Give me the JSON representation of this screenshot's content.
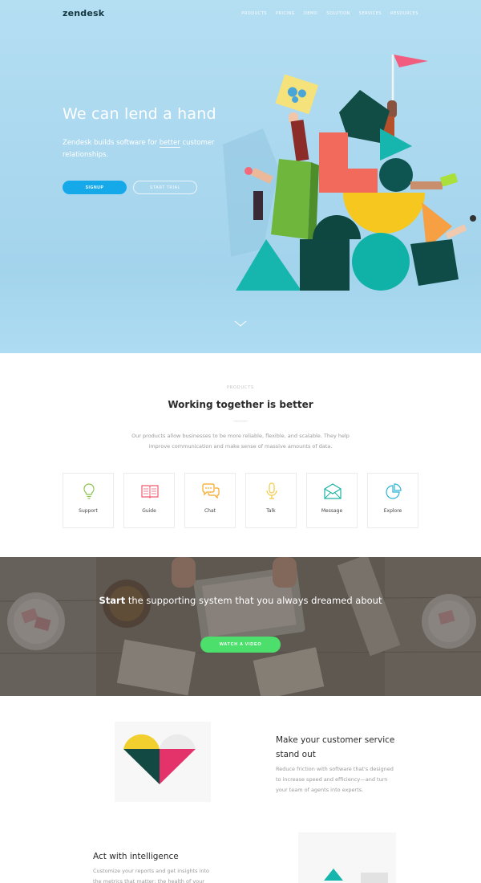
{
  "brand": {
    "logo": "zendesk"
  },
  "nav": {
    "items": [
      "PRODUCTS",
      "PRICING",
      "DEMO",
      "SOLUTION",
      "SERVICES",
      "RESOURCES"
    ]
  },
  "hero": {
    "title": "We can lend a hand",
    "subtitle_before": "Zendesk builds software for ",
    "subtitle_emph": "better",
    "subtitle_after": " customer relationships.",
    "signup_label": "SIGNUP",
    "trial_label": "START TRIAL"
  },
  "products": {
    "eyebrow": "PRODUCTS",
    "title": "Working together is better",
    "description": "Our products allow businesses to be more reliable, flexible, and scalable. They help improve communication and make sense of massive amounts of data.",
    "cards": [
      {
        "label": "Support",
        "icon": "lightbulb-icon",
        "color": "#8bc34a"
      },
      {
        "label": "Guide",
        "icon": "book-icon",
        "color": "#ef5b6e"
      },
      {
        "label": "Chat",
        "icon": "chat-bubbles-icon",
        "color": "#f5a623"
      },
      {
        "label": "Talk",
        "icon": "microphone-icon",
        "color": "#f5c842"
      },
      {
        "label": "Message",
        "icon": "envelope-icon",
        "color": "#1cb3a5"
      },
      {
        "label": "Explore",
        "icon": "pie-chart-icon",
        "color": "#2bb3d8"
      }
    ]
  },
  "banner": {
    "emph": "Start",
    "text": " the supporting system that you always dreamed about",
    "button_label": "WATCH A VIDEO"
  },
  "feature1": {
    "title": "Make your customer service stand out",
    "description": "Reduce friction with software that's designed to increase speed and efficiency—and turn your team of agents into experts."
  },
  "feature2": {
    "title": "Act with intelligence",
    "description": "Customize your reports and get insights into the metrics that matter: the health of your"
  },
  "colors": {
    "accent_blue": "#16a9ea",
    "accent_green": "#4ddf6b",
    "hero_bg": "#b4def2",
    "dark_teal": "#134b4a",
    "coral": "#f46a5a",
    "yellow": "#f7c820",
    "teal": "#12b3a8",
    "magenta": "#e4336b"
  }
}
